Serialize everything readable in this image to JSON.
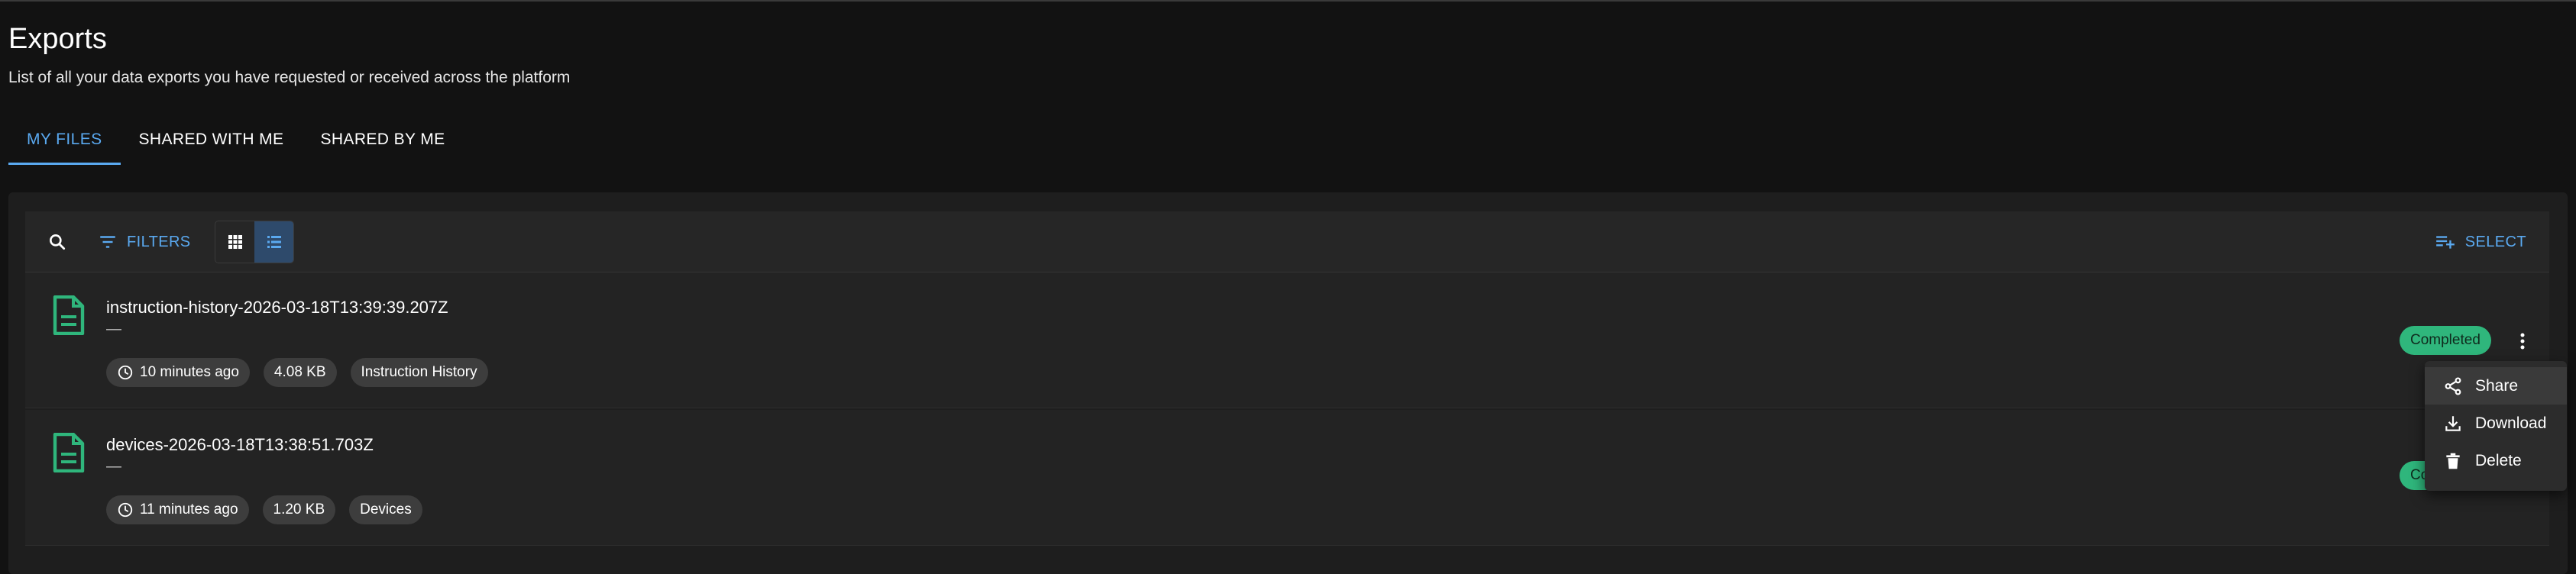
{
  "header": {
    "title": "Exports",
    "subtitle": "List of all your data exports you have requested or received across the platform"
  },
  "tabs": [
    {
      "label": "MY FILES",
      "active": true
    },
    {
      "label": "SHARED WITH ME",
      "active": false
    },
    {
      "label": "SHARED BY ME",
      "active": false
    }
  ],
  "toolbar": {
    "filters_label": "FILTERS",
    "select_label": "SELECT",
    "view_mode": "list"
  },
  "files": [
    {
      "name": "instruction-history-2026-03-18T13:39:39.207Z",
      "description": "—",
      "age": "10 minutes ago",
      "size": "4.08 KB",
      "type": "Instruction History",
      "status": "Completed"
    },
    {
      "name": "devices-2026-03-18T13:38:51.703Z",
      "description": "—",
      "age": "11 minutes ago",
      "size": "1.20 KB",
      "type": "Devices",
      "status": "Com"
    }
  ],
  "context_menu": {
    "items": [
      {
        "label": "Share",
        "icon": "share-icon"
      },
      {
        "label": "Download",
        "icon": "download-icon"
      },
      {
        "label": "Delete",
        "icon": "trash-icon"
      }
    ]
  },
  "colors": {
    "accent": "#5aa9f0",
    "status_completed": "#2fb67c",
    "file_icon": "#2fb67c",
    "background": "#121212"
  }
}
